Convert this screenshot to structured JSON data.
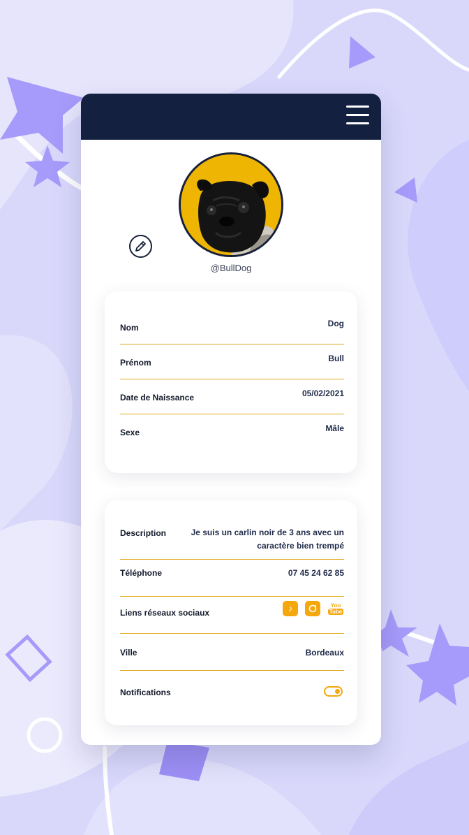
{
  "colors": {
    "header": "#132040",
    "accent": "#f5a70e",
    "avatar_bg": "#eeb602",
    "background": "#d9d8fb",
    "shape_purple": "#a69afa"
  },
  "header": {
    "menu_icon": "hamburger-menu-icon"
  },
  "profile": {
    "username": "@BullDog",
    "edit_icon": "pencil-icon"
  },
  "identity": {
    "rows": [
      {
        "label": "Nom",
        "value": "Dog"
      },
      {
        "label": "Prénom",
        "value": "Bull"
      },
      {
        "label": "Date de Naissance",
        "value": "05/02/2021"
      },
      {
        "label": "Sexe",
        "value": "Mâle"
      }
    ]
  },
  "details": {
    "description_label": "Description",
    "description_value": "Je suis un carlin noir de 3 ans avec un caractère bien trempé",
    "phone_label": "Téléphone",
    "phone_value": "07 45 24 62 85",
    "social_label": "Liens réseaux sociaux",
    "social_icons": [
      "tiktok-icon",
      "instagram-icon",
      "youtube-icon"
    ],
    "youtube_top": "You",
    "youtube_bottom": "Tube",
    "city_label": "Ville",
    "city_value": "Bordeaux",
    "notifications_label": "Notifications",
    "notifications_on": true
  }
}
